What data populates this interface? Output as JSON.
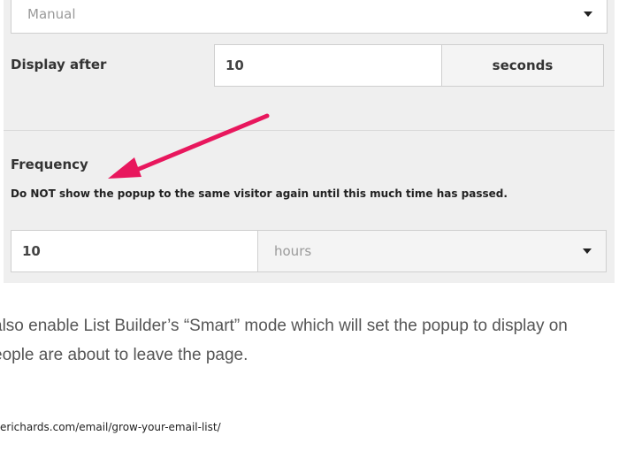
{
  "form": {
    "mode_select_value": "Manual",
    "display_after_label": "Display after",
    "display_after_value": "10",
    "display_after_unit": "seconds",
    "frequency_label": "Frequency",
    "frequency_description": "Do NOT show the popup to the same visitor again until this much time has passed.",
    "frequency_value": "10",
    "frequency_unit": "hours"
  },
  "annotation": {
    "arrow_color": "#e8175d"
  },
  "article": {
    "line1": "also enable List Builder’s “Smart” mode which will set the popup to display on",
    "line2": "eople are about to leave the page.",
    "url": "erichards.com/email/grow-your-email-list/"
  }
}
